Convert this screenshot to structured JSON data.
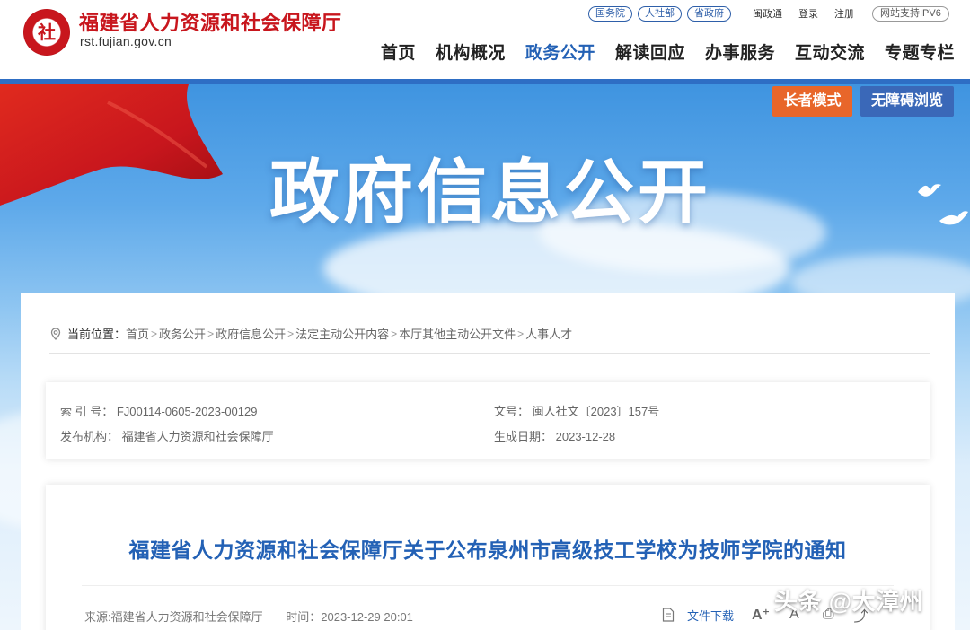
{
  "header": {
    "site_title": "福建省人力资源和社会保障厅",
    "site_domain": "rst.fujian.gov.cn",
    "logo_char": "社",
    "top_pills": [
      "国务院",
      "人社部",
      "省政府"
    ],
    "top_links": [
      "闽政通",
      "登录",
      "注册"
    ],
    "ipv6": "网站支持IPV6",
    "nav": [
      "首页",
      "机构概况",
      "政务公开",
      "解读回应",
      "办事服务",
      "互动交流",
      "专题专栏"
    ],
    "active_nav": "政务公开"
  },
  "banner": {
    "title": "政府信息公开",
    "elder_mode": "长者模式",
    "accessible": "无障碍浏览"
  },
  "breadcrumb": {
    "label": "当前位置：",
    "items": [
      "首页",
      "政务公开",
      "政府信息公开",
      "法定主动公开内容",
      "本厅其他主动公开文件",
      "人事人才"
    ]
  },
  "meta": {
    "index_label": "索 引 号：",
    "index_value": "FJ00114-0605-2023-00129",
    "doc_label": "文号：",
    "doc_value": "闽人社文〔2023〕157号",
    "org_label": "发布机构：",
    "org_value": "福建省人力资源和社会保障厅",
    "date_label": "生成日期：",
    "date_value": "2023-12-28"
  },
  "article": {
    "title": "福建省人力资源和社会保障厅关于公布泉州市高级技工学校为技师学院的通知",
    "source": "来源:福建省人力资源和社会保障厅",
    "time_label": "时间：",
    "time_value": "2023-12-29 20:01",
    "download": "文件下载"
  },
  "watermark": "头条 @大漳州",
  "colors": {
    "brand_red": "#c8161d",
    "nav_blue": "#2361b5",
    "elder_orange": "#e8662a",
    "access_blue": "#3a68b8"
  }
}
